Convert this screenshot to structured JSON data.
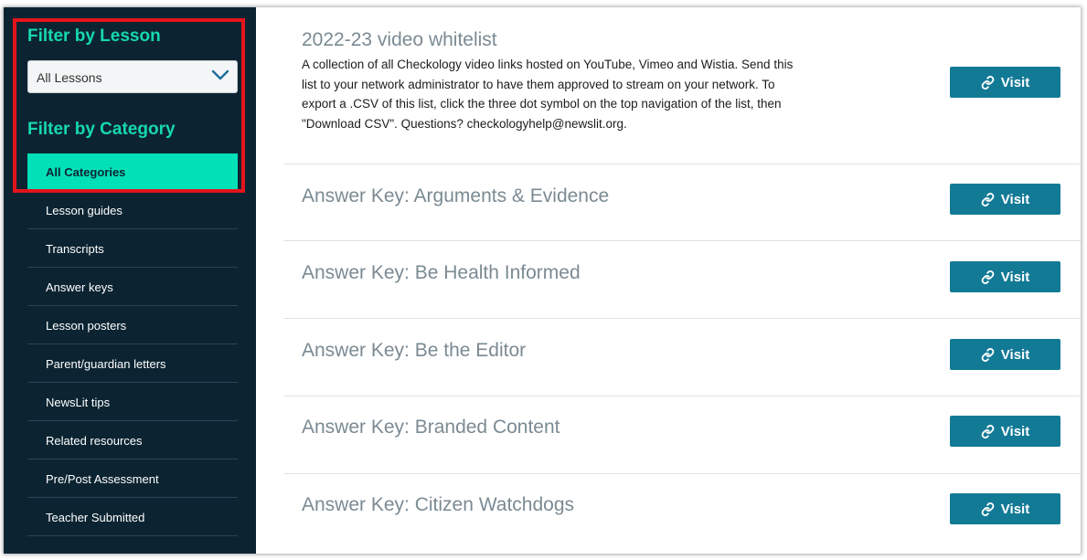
{
  "sidebar": {
    "lesson_filter_heading": "Filter by Lesson",
    "lesson_select_value": "All Lessons",
    "category_filter_heading": "Filter by Category",
    "active_category": "All Categories",
    "categories": [
      "Lesson guides",
      "Transcripts",
      "Answer keys",
      "Lesson posters",
      "Parent/guardian letters",
      "NewsLit tips",
      "Related resources",
      "Pre/Post Assessment",
      "Teacher Submitted"
    ]
  },
  "resources": [
    {
      "title": "2022-23 video whitelist",
      "description": "A collection of all Checkology video links hosted on YouTube, Vimeo and Wistia. Send this list to your network administrator to have them approved to stream on your network. To export a .CSV of this list, click the three dot symbol on the top navigation of the list, then \"Download CSV\". Questions? checkologyhelp@newslit.org.",
      "button": "Visit"
    },
    {
      "title": "Answer Key: Arguments & Evidence",
      "button": "Visit"
    },
    {
      "title": "Answer Key: Be Health Informed",
      "button": "Visit"
    },
    {
      "title": "Answer Key: Be the Editor",
      "button": "Visit"
    },
    {
      "title": "Answer Key: Branded Content",
      "button": "Visit"
    },
    {
      "title": "Answer Key: Citizen Watchdogs",
      "button": "Visit"
    }
  ],
  "icons": {
    "dropdown": "chevron-down-icon",
    "button": "link-icon"
  },
  "colors": {
    "sidebar_bg": "#0c2432",
    "accent_teal": "#16d8b0",
    "active_category_bg": "#02e0b8",
    "visit_button": "#137a96",
    "annotation_box": "#e3141c"
  }
}
